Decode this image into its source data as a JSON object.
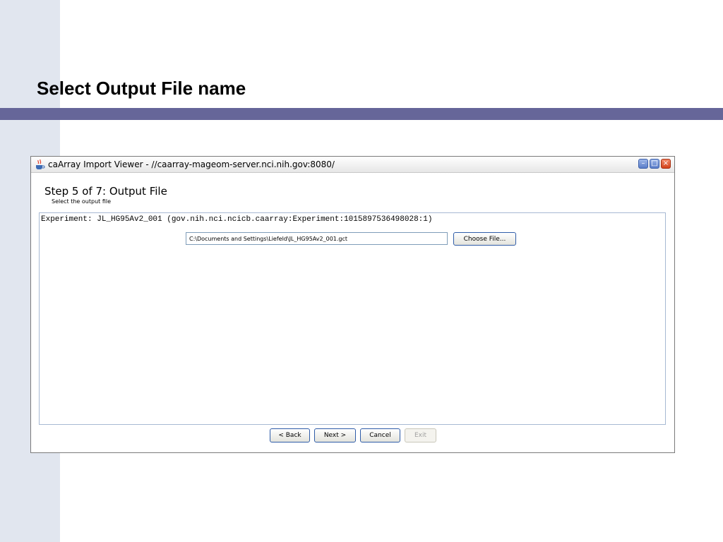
{
  "slide": {
    "title": "Select Output File name"
  },
  "window": {
    "title": "caArray Import Viewer - //caarray-mageom-server.nci.nih.gov:8080/",
    "controls": {
      "minimize": "–",
      "maximize": "□",
      "close": "×"
    }
  },
  "wizard": {
    "step_title": "Step 5 of 7: Output File",
    "step_subtitle": "Select the output file",
    "experiment_label": "Experiment: JL_HG95Av2_001 (gov.nih.nci.ncicb.caarray:Experiment:1015897536498028:1)",
    "output_path": "C:\\Documents and Settings\\Liefeld\\JL_HG95Av2_001.gct",
    "choose_file_label": "Choose File...",
    "buttons": {
      "back": "< Back",
      "next": "Next >",
      "cancel": "Cancel",
      "exit": "Exit"
    }
  },
  "colors": {
    "left_strip": "#e1e6ef",
    "title_rule": "#666699"
  }
}
